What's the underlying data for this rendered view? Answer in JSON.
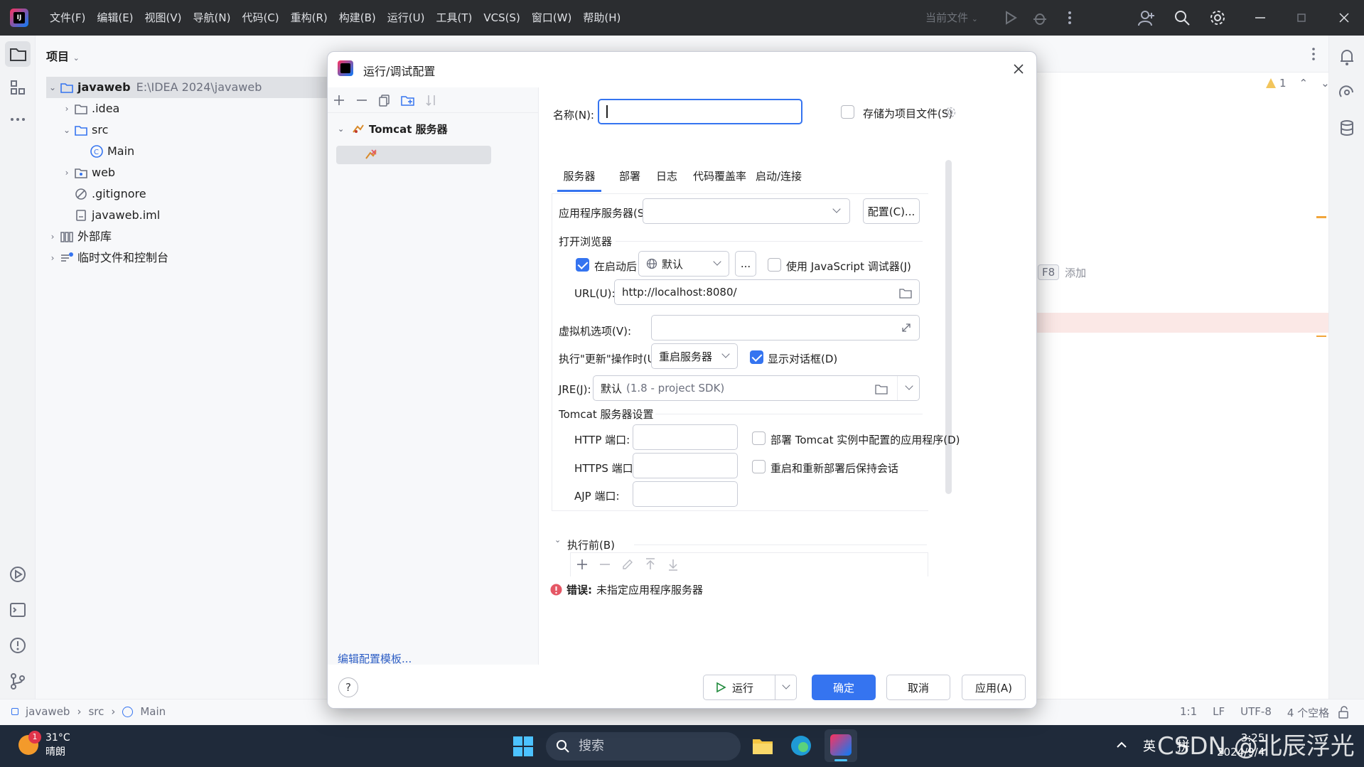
{
  "menubar": {
    "items": [
      "文件(F)",
      "编辑(E)",
      "视图(V)",
      "导航(N)",
      "代码(C)",
      "重构(R)",
      "构建(B)",
      "运行(U)",
      "工具(T)",
      "VCS(S)",
      "窗口(W)",
      "帮助(H)"
    ],
    "current_file": "当前文件"
  },
  "project": {
    "header": "项目",
    "root_name": "javaweb",
    "root_path": "E:\\IDEA 2024\\javaweb",
    "items": {
      "idea": ".idea",
      "src": "src",
      "main": "Main",
      "web": "web",
      "gitignore": ".gitignore",
      "iml": "javaweb.iml",
      "external": "外部库",
      "scratches": "临时文件和控制台"
    }
  },
  "editor": {
    "warning_count": "1",
    "key_hint": "F8",
    "key_hint_text": "添加"
  },
  "dialog": {
    "title": "运行/调试配置",
    "tree": {
      "group_label": "Tomcat 服务器"
    },
    "edit_templates": "编辑配置模板...",
    "name_label": "名称(N):",
    "name_value": "",
    "store_label": "存储为项目文件(S)",
    "tabs": [
      "服务器",
      "部署",
      "日志",
      "代码覆盖率",
      "启动/连接"
    ],
    "app_server_label": "应用程序服务器(S):",
    "app_server_value": "",
    "configure_button": "配置(C)...",
    "open_browser_section": "打开浏览器",
    "after_launch_label": "在启动后",
    "browser_value": "默认",
    "ellipsis_button": "...",
    "js_debugger_label": "使用 JavaScript 调试器(J)",
    "url_label": "URL(U):",
    "url_value": "http://localhost:8080/",
    "vm_options_label": "虚拟机选项(V):",
    "vm_options_value": "",
    "on_update_label": "执行\"更新\"操作时(U):",
    "on_update_value": "重启服务器",
    "show_dialog_label": "显示对话框(D)",
    "jre_label": "JRE(J):",
    "jre_value": "默认",
    "jre_hint": "(1.8 - project SDK)",
    "tomcat_settings_section": "Tomcat 服务器设置",
    "http_port_label": "HTTP 端口:",
    "https_port_label": "HTTPS 端口:",
    "ajp_port_label": "AJP 端口:",
    "http_port_value": "",
    "https_port_value": "",
    "ajp_port_value": "",
    "deploy_apps_label": "部署 Tomcat 实例中配置的应用程序(D)",
    "preserve_sessions_label": "重启和重新部署后保持会话",
    "before_launch_label": "执行前(B)",
    "error_prefix": "错误:",
    "error_text": "未指定应用程序服务器",
    "run_button": "运行",
    "ok_button": "确定",
    "cancel_button": "取消",
    "apply_button": "应用(A)",
    "help_glyph": "?"
  },
  "statusbar": {
    "breadcrumb": [
      "javaweb",
      "src",
      "Main"
    ],
    "position": "1:1",
    "line_sep": "LF",
    "encoding": "UTF-8",
    "indent": "4 个空格"
  },
  "taskbar": {
    "temperature": "31°C",
    "weather": "晴朗",
    "weather_badge": "1",
    "search_placeholder": "搜索",
    "ime": "英",
    "ime2": "拼",
    "watermark": "CSDN @北辰浮光",
    "time": "3:25",
    "date": "2024/9/4"
  },
  "colors": {
    "accent": "#3574f0",
    "error": "#e55765",
    "title_bg": "#2b2d30",
    "taskbar_bg": "#1f2a3a"
  }
}
